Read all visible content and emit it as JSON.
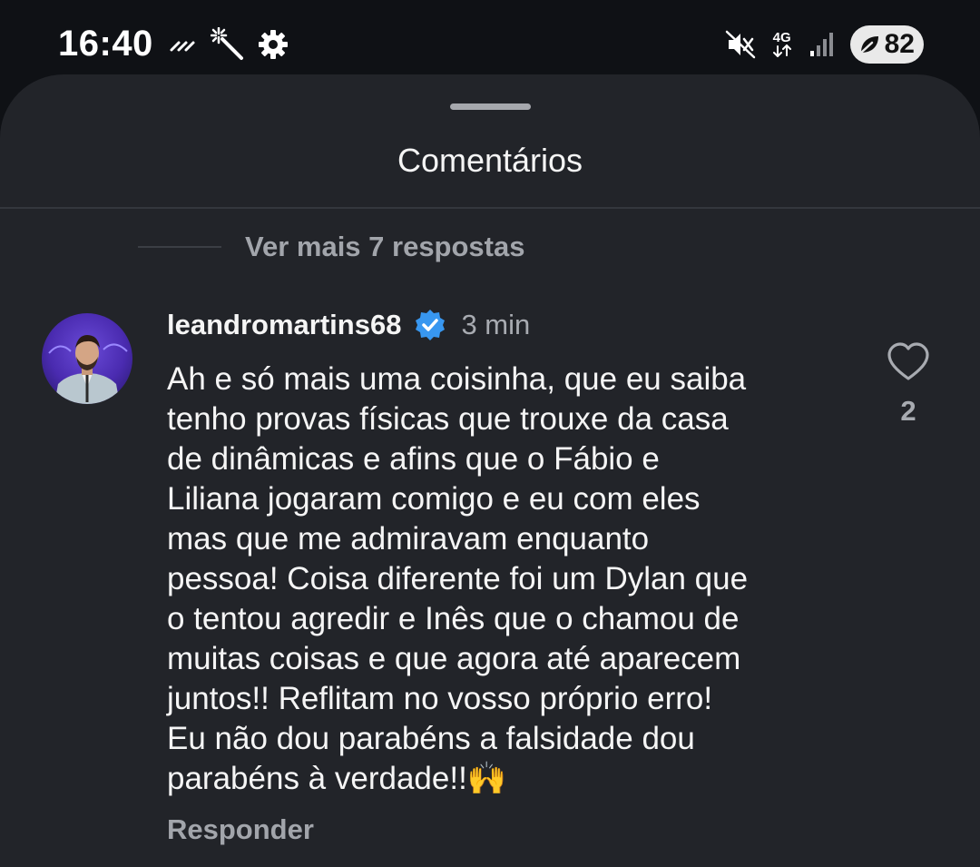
{
  "status_bar": {
    "time": "16:40",
    "network": "4G",
    "battery": "82"
  },
  "sheet": {
    "title": "Comentários",
    "more_replies": "Ver mais 7 respostas"
  },
  "comment": {
    "username": "leandromartins68",
    "verified": true,
    "timestamp": "3 min",
    "text": "Ah e só mais uma coisinha, que eu saiba\ntenho provas físicas que trouxe da casa\nde dinâmicas e afins que o Fábio e\nLiliana jogaram comigo e eu com eles\nmas que me admiravam enquanto\npessoa! Coisa diferente foi um Dylan que\no tentou agredir e Inês que o chamou de\nmuitas coisas e que agora até aparecem\njuntos!! Reflitam no vosso próprio erro!\nEu não dou parabéns a falsidade dou\nparabéns à verdade!!🙌",
    "reply_label": "Responder",
    "like_count": "2"
  },
  "icons": {
    "status_left": [
      "haptics-icon",
      "magic-wand-icon",
      "gear-icon"
    ],
    "status_right": [
      "mute-vibrate-icon",
      "data-arrows-icon",
      "signal-icon",
      "battery-saver-icon"
    ],
    "comment": [
      "verified-badge-icon",
      "heart-outline-icon"
    ]
  },
  "colors": {
    "background": "#0f1115",
    "sheet": "#222429",
    "verified_blue": "#3897f0",
    "muted_text": "#a2a5ab"
  }
}
